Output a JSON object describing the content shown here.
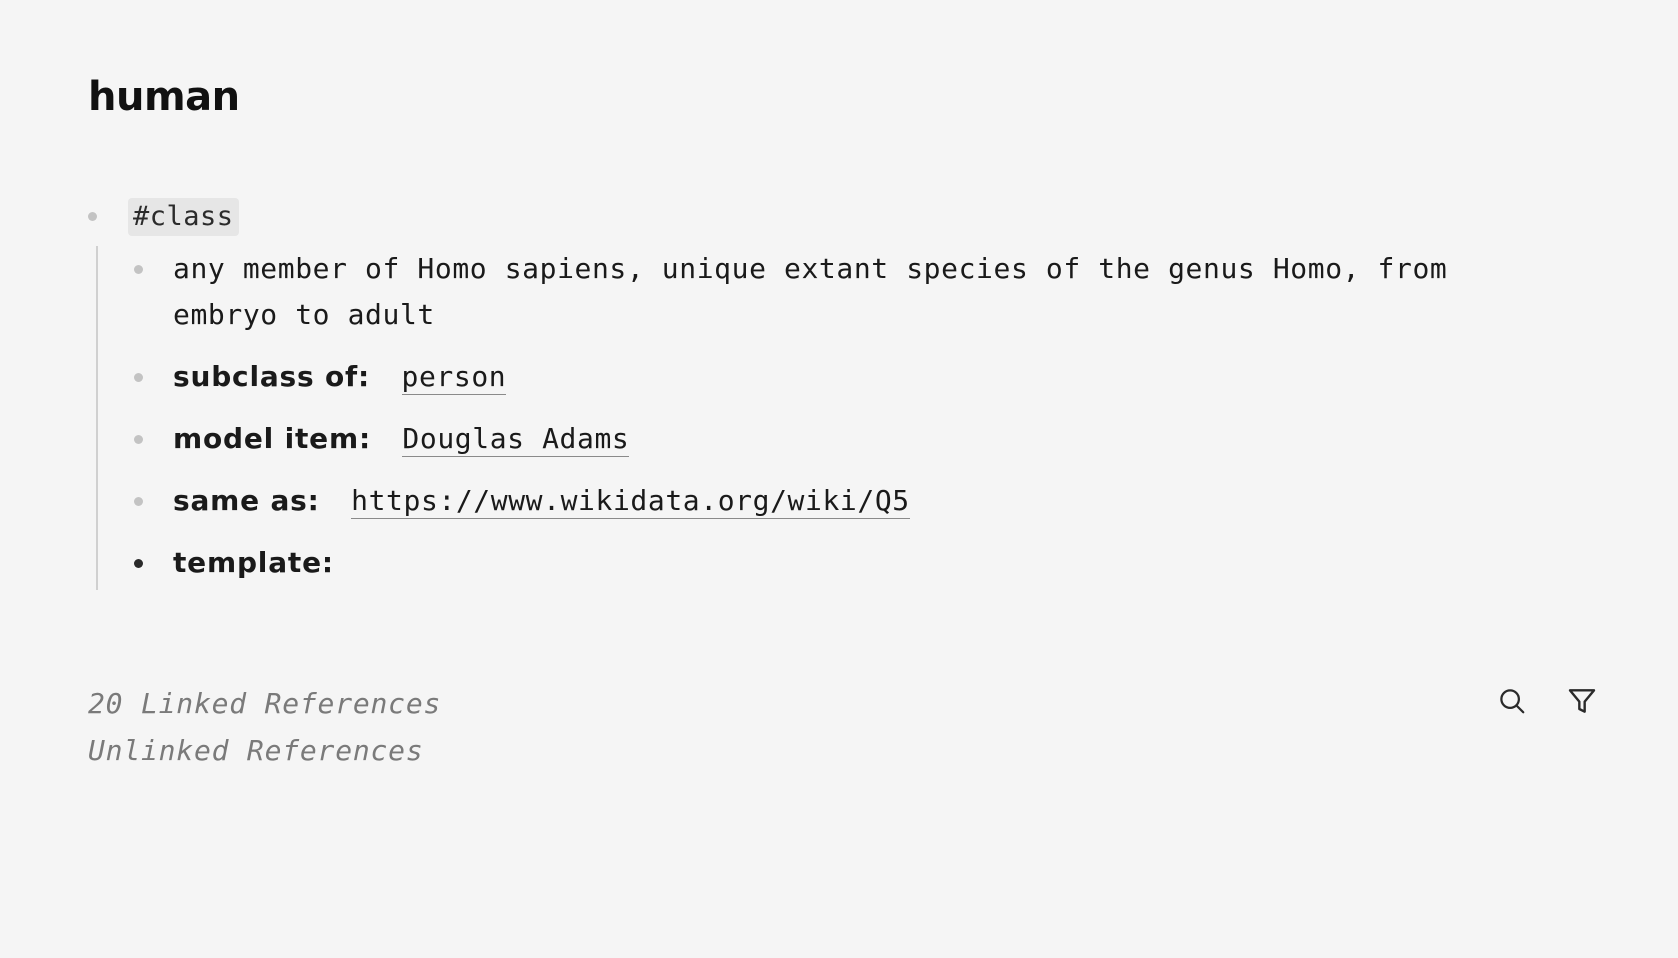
{
  "page": {
    "title": "human"
  },
  "root_block": {
    "tag": "#class",
    "children": [
      {
        "type": "text",
        "text": "any member of Homo sapiens, unique extant species of the genus Homo, from embryo to adult"
      },
      {
        "type": "property",
        "key": "subclass of:",
        "value": "person"
      },
      {
        "type": "property",
        "key": "model item:",
        "value": "Douglas Adams"
      },
      {
        "type": "property",
        "key": "same as:",
        "value": "https://www.wikidata.org/wiki/Q5"
      },
      {
        "type": "property",
        "key": "template:",
        "value": ""
      }
    ]
  },
  "references": {
    "linked": "20 Linked References",
    "unlinked": "Unlinked References"
  },
  "icons": {
    "search": "search-icon",
    "filter": "filter-icon"
  },
  "colors": {
    "background": "#f5f5f5",
    "bullet_light": "#c3c3c3",
    "bullet_active": "#2a2a2a",
    "tag_background": "#e6e6e6",
    "muted_text": "#7a7a7a"
  }
}
